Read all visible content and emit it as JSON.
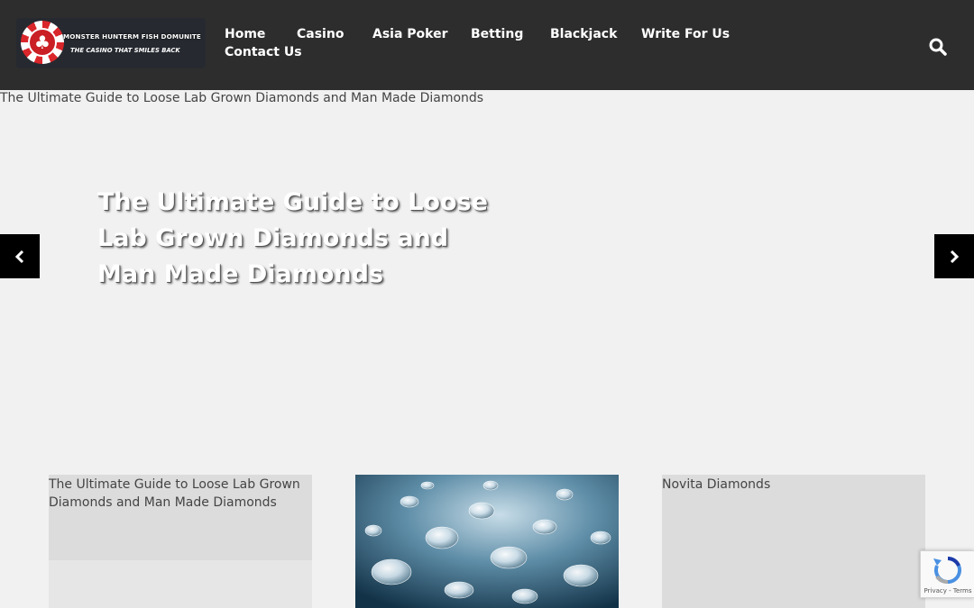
{
  "site": {
    "logo": {
      "title": "Monster Hunterm Fish Domunite",
      "tagline": "The Casino That Smiles Back",
      "icon": "poker-chip-club-icon"
    },
    "nav": [
      {
        "label": "Home"
      },
      {
        "label": "Casino"
      },
      {
        "label": "Asia Poker"
      },
      {
        "label": "Betting"
      },
      {
        "label": "Blackjack"
      },
      {
        "label": "Write For Us"
      },
      {
        "label": "Contact Us"
      }
    ],
    "search_icon": "search-icon"
  },
  "hero": {
    "image_alt": "The Ultimate Guide to Loose Lab Grown Diamonds and Man Made Diamonds",
    "title": "The Ultimate Guide to Loose Lab Grown Diamonds and Man Made Diamonds",
    "prev_icon": "chevron-left-icon",
    "next_icon": "chevron-right-icon"
  },
  "cards": [
    {
      "image_alt": "The Ultimate Guide to Loose Lab Grown Diamonds and Man Made Diamonds"
    },
    {
      "image_alt": "",
      "image": "diamonds-photo"
    },
    {
      "image_alt": "Novita Diamonds"
    }
  ],
  "recaptcha": {
    "links": "Privacy - Terms"
  },
  "colors": {
    "header_bg": "#2d2d2d",
    "page_bg": "#f1f1f1",
    "arrow_bg": "#000000",
    "chip_red": "#d9262b"
  }
}
